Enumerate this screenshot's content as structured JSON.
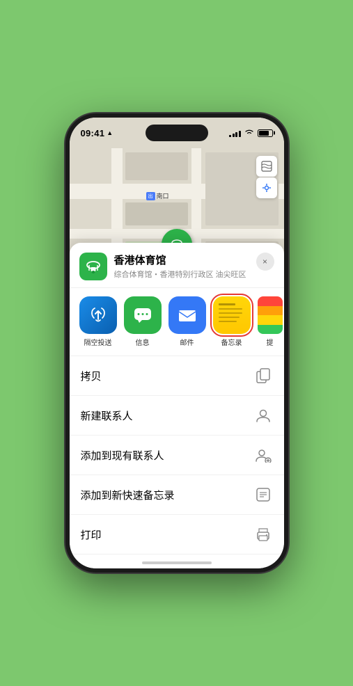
{
  "status_bar": {
    "time": "09:41",
    "location_arrow": "▶"
  },
  "map": {
    "south_gate_badge": "出",
    "south_gate_label": "南口",
    "venue_name_on_map": "香港体育馆",
    "map_icon": "🗺"
  },
  "bottom_sheet": {
    "venue_name": "香港体育馆",
    "venue_subtitle": "综合体育馆・香港特别行政区 油尖旺区",
    "close_label": "×"
  },
  "share_items": [
    {
      "id": "airdrop",
      "label": "隔空投送",
      "emoji": "📡"
    },
    {
      "id": "message",
      "label": "信息",
      "emoji": "💬"
    },
    {
      "id": "mail",
      "label": "邮件",
      "emoji": "✉️"
    },
    {
      "id": "notes",
      "label": "备忘录",
      "emoji": ""
    },
    {
      "id": "more",
      "label": "提",
      "emoji": ""
    }
  ],
  "actions": [
    {
      "id": "copy",
      "label": "拷贝",
      "icon": "copy"
    },
    {
      "id": "new-contact",
      "label": "新建联系人",
      "icon": "person"
    },
    {
      "id": "add-contact",
      "label": "添加到现有联系人",
      "icon": "person-add"
    },
    {
      "id": "quick-note",
      "label": "添加到新快速备忘录",
      "icon": "note"
    },
    {
      "id": "print",
      "label": "打印",
      "icon": "printer"
    }
  ],
  "colors": {
    "green": "#2db34a",
    "blue": "#3478f6",
    "red": "#e53935",
    "yellow": "#ffd60a"
  }
}
